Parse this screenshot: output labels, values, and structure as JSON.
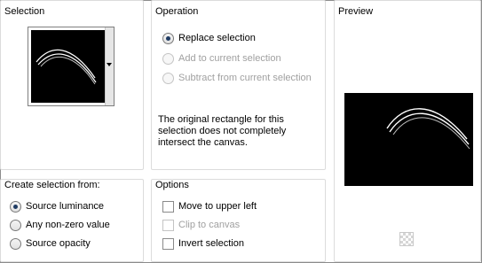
{
  "selection": {
    "title": "Selection"
  },
  "operation": {
    "title": "Operation",
    "options": [
      {
        "label": "Replace selection",
        "checked": true,
        "enabled": true
      },
      {
        "label": "Add to current selection",
        "checked": false,
        "enabled": false
      },
      {
        "label": "Subtract from current selection",
        "checked": false,
        "enabled": false
      }
    ],
    "message": "The original rectangle for this selection does not completely intersect the canvas."
  },
  "preview": {
    "title": "Preview"
  },
  "create_from": {
    "title": "Create selection from:",
    "options": [
      {
        "label": "Source luminance",
        "checked": true
      },
      {
        "label": "Any non-zero value",
        "checked": false
      },
      {
        "label": "Source opacity",
        "checked": false
      }
    ]
  },
  "options": {
    "title": "Options",
    "items": [
      {
        "label": "Move to upper left",
        "checked": false,
        "enabled": true
      },
      {
        "label": "Clip to canvas",
        "checked": false,
        "enabled": false
      },
      {
        "label": "Invert selection",
        "checked": false,
        "enabled": true
      }
    ]
  },
  "colors": {
    "canvas": "#000000",
    "stroke": "#ffffff"
  },
  "icons": {
    "dropdown": "chevron-down-icon",
    "transparency": "checkerboard-icon"
  }
}
